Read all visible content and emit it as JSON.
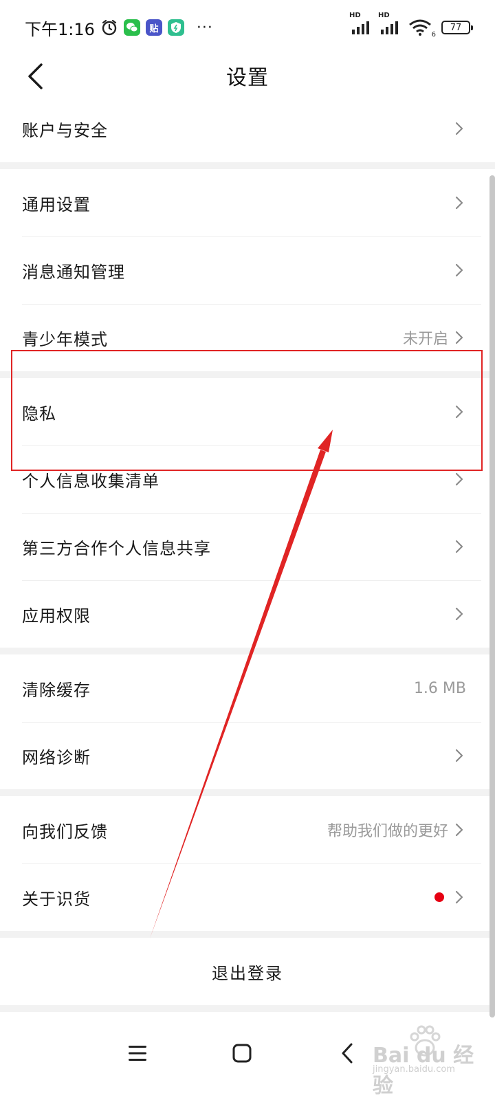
{
  "status_bar": {
    "time": "下午1:16",
    "network_1": "HD",
    "network_2": "HD",
    "wifi_sub": "6",
    "battery": "77",
    "more": "···",
    "tieba_glyph": "贴"
  },
  "nav": {
    "title": "设置"
  },
  "settings": {
    "account": {
      "label": "账户与安全"
    },
    "general": {
      "label": "通用设置"
    },
    "notify": {
      "label": "消息通知管理"
    },
    "youth": {
      "label": "青少年模式",
      "value": "未开启"
    },
    "privacy": {
      "label": "隐私"
    },
    "collect": {
      "label": "个人信息收集清单"
    },
    "share": {
      "label": "第三方合作个人信息共享"
    },
    "perm": {
      "label": "应用权限"
    },
    "cache": {
      "label": "清除缓存",
      "value": "1.6 MB"
    },
    "network": {
      "label": "网络诊断"
    },
    "feedback": {
      "label": "向我们反馈",
      "value": "帮助我们做的更好"
    },
    "about": {
      "label": "关于识货"
    },
    "logout": {
      "label": "退出登录"
    }
  },
  "watermark": {
    "brand": "Bai du 经验",
    "url": "jingyan.baidu.com"
  },
  "colors": {
    "accent_red": "#e02424",
    "badge_dot": "#e60012",
    "divider_gap": "#f2f2f2"
  },
  "icons": {
    "back": "chevron-left-icon",
    "row_arrow": "chevron-right-icon",
    "menu": "menu-icon",
    "home": "home-icon",
    "sys_back": "back-icon"
  }
}
